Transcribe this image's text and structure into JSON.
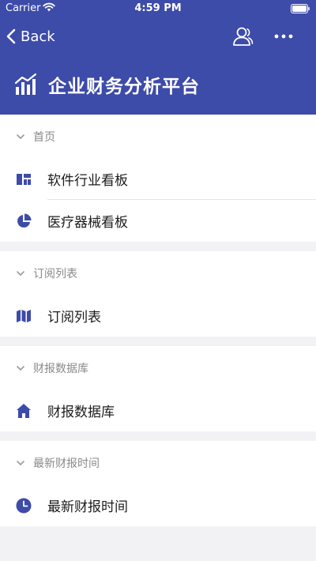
{
  "status": {
    "carrier": "Carrier",
    "time": "4:59 PM"
  },
  "nav": {
    "back_label": "Back"
  },
  "page": {
    "title": "企业财务分析平台"
  },
  "sections": [
    {
      "header": "首页",
      "items": [
        {
          "label": "软件行业看板",
          "icon": "dashboard-icon"
        },
        {
          "label": "医疗器械看板",
          "icon": "pie-chart-icon"
        }
      ]
    },
    {
      "header": "订阅列表",
      "items": [
        {
          "label": "订阅列表",
          "icon": "map-icon"
        }
      ]
    },
    {
      "header": "财报数据库",
      "items": [
        {
          "label": "财报数据库",
          "icon": "home-icon"
        }
      ]
    },
    {
      "header": "最新财报时间",
      "items": [
        {
          "label": "最新财报时间",
          "icon": "clock-icon"
        }
      ]
    }
  ],
  "colors": {
    "primary": "#3d4ba9",
    "background": "#f2f2f4",
    "secondary_text": "#8a8a8e"
  }
}
